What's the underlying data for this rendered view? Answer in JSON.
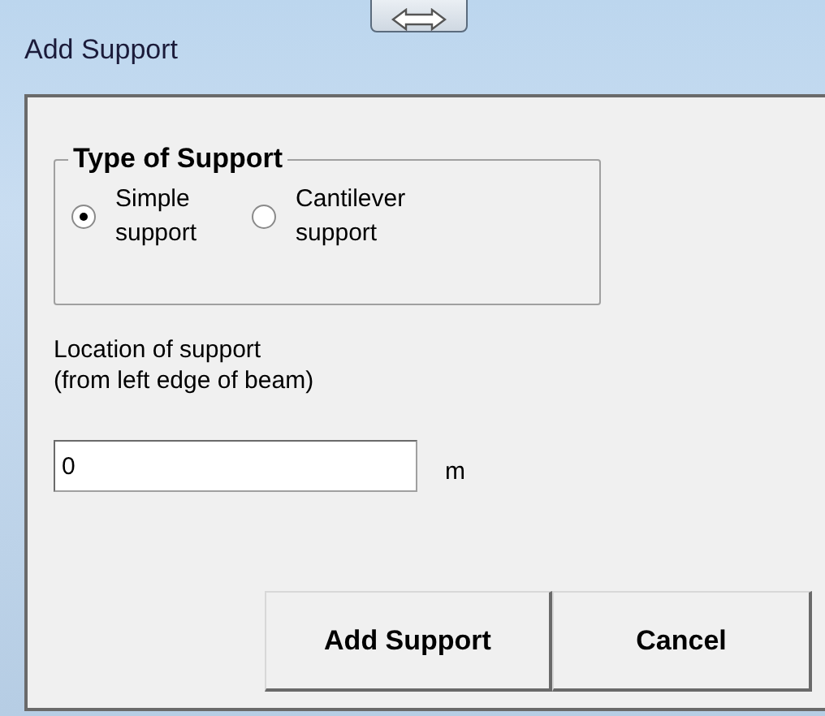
{
  "window": {
    "title": "Add Support"
  },
  "support_type": {
    "title": "Type of Support",
    "options": [
      {
        "label": "Simple\nsupport",
        "selected": true
      },
      {
        "label": "Cantilever\nsupport",
        "selected": false
      }
    ]
  },
  "location": {
    "label": "Location of support\n(from left edge of beam)",
    "value": "0",
    "unit": "m"
  },
  "buttons": [
    "Add Support",
    "Cancel"
  ]
}
